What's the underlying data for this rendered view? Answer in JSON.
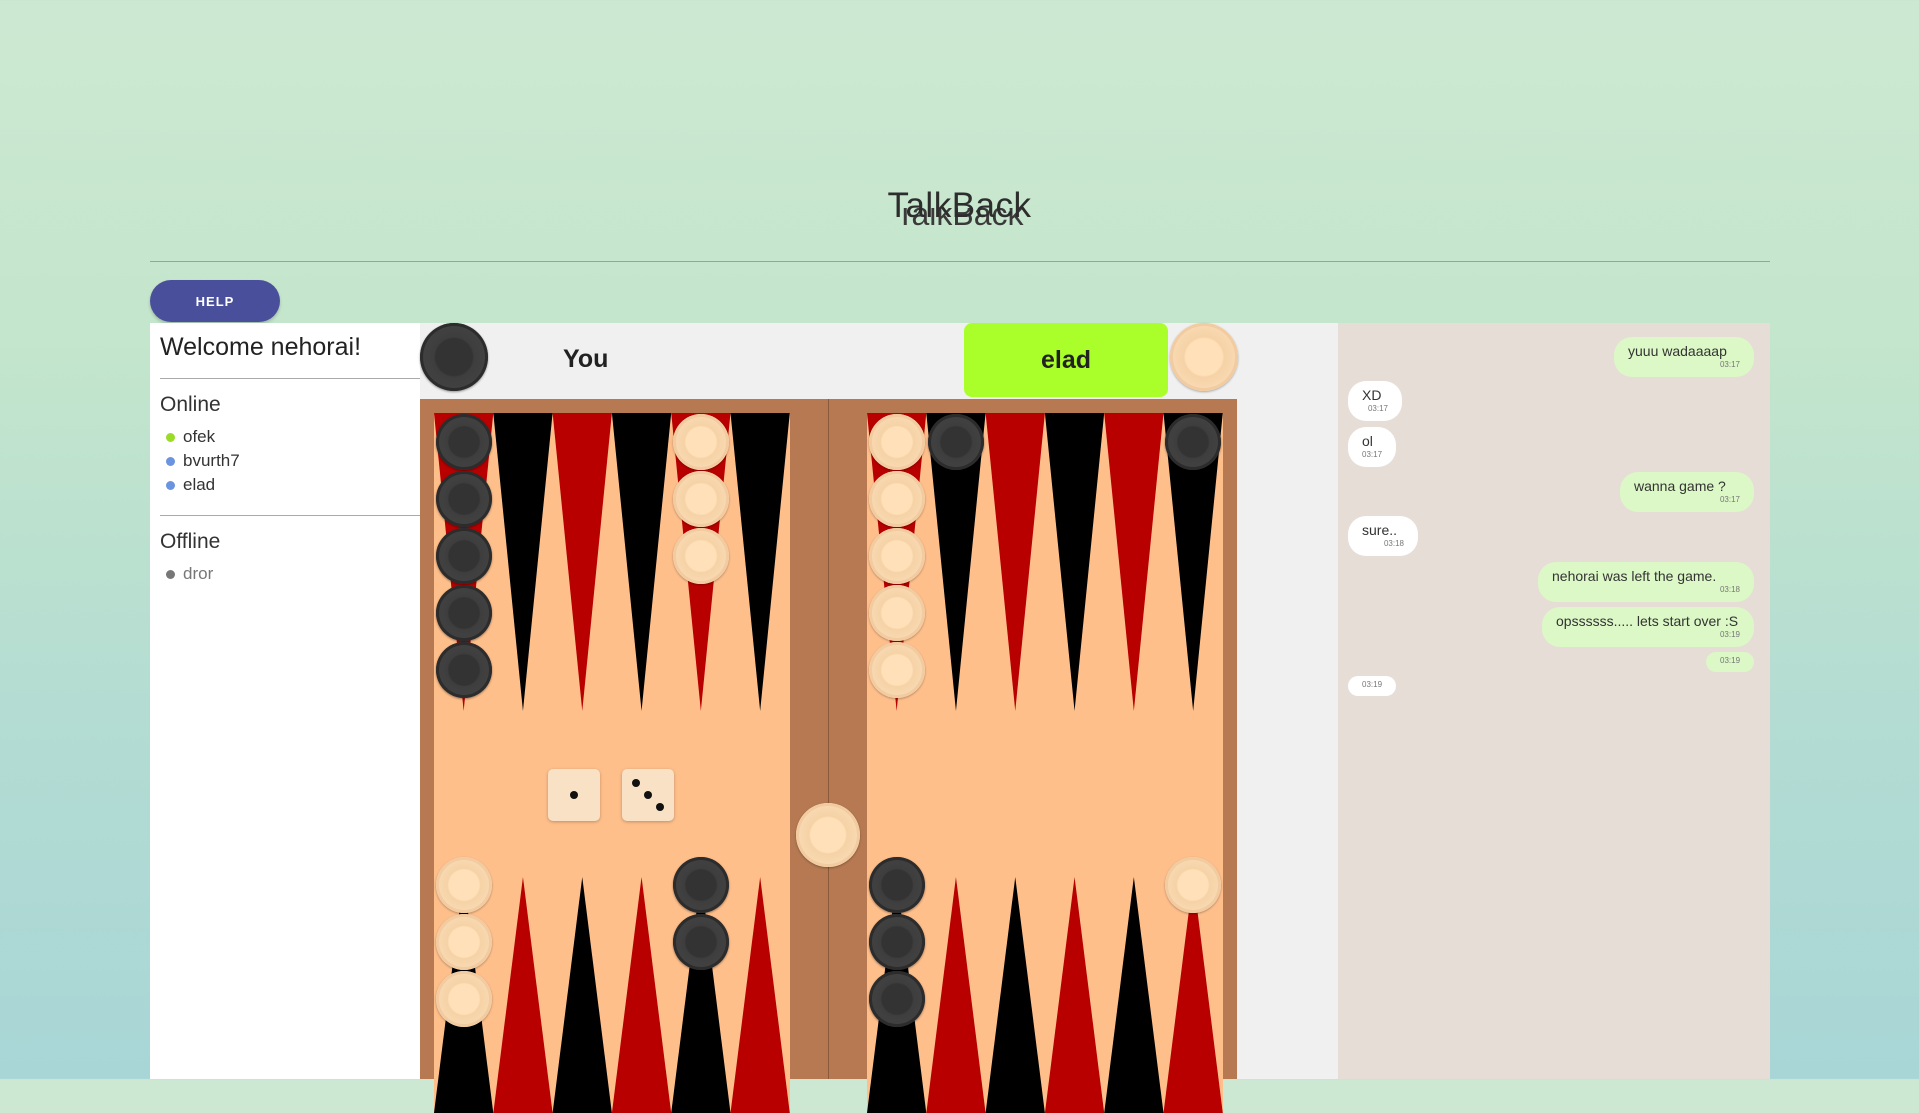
{
  "app": {
    "title": "TalkBack",
    "help_label": "HELP"
  },
  "sidebar": {
    "welcome": "Welcome nehorai!",
    "online_title": "Online",
    "online_users": [
      {
        "name": "ofek",
        "color": "#9bdc28"
      },
      {
        "name": "bvurth7",
        "color": "#6a93e0"
      },
      {
        "name": "elad",
        "color": "#6a93e0"
      }
    ],
    "offline_title": "Offline",
    "offline_users": [
      {
        "name": "dror",
        "color": "#777777"
      }
    ]
  },
  "game": {
    "you_label": "You",
    "opponent_label": "elad",
    "you_color": "#3e3e3e",
    "opponent_color": "#f8d9b0",
    "current_turn": "elad",
    "turn_color": "#aaff2a",
    "dice": [
      1,
      3
    ],
    "colors": {
      "board": "#b67952",
      "field": "#ffbf8b",
      "red_point": "#b80000",
      "black_point": "#000000",
      "dark_checker": "#3e3e3e",
      "light_checker": "#f8d9b0"
    },
    "points_top": [
      {
        "color": "red",
        "checkers": 5,
        "player": "dark"
      },
      {
        "color": "black",
        "checkers": 0
      },
      {
        "color": "red",
        "checkers": 0
      },
      {
        "color": "black",
        "checkers": 0
      },
      {
        "color": "red",
        "checkers": 3,
        "player": "light"
      },
      {
        "color": "black",
        "checkers": 0
      },
      {
        "color": "red",
        "checkers": 5,
        "player": "light"
      },
      {
        "color": "black",
        "checkers": 1,
        "player": "dark"
      },
      {
        "color": "red",
        "checkers": 0
      },
      {
        "color": "black",
        "checkers": 0
      },
      {
        "color": "red",
        "checkers": 0
      },
      {
        "color": "black",
        "checkers": 1,
        "player": "dark"
      }
    ],
    "points_bottom": [
      {
        "color": "black",
        "checkers": 3,
        "player": "light"
      },
      {
        "color": "red",
        "checkers": 0
      },
      {
        "color": "black",
        "checkers": 0
      },
      {
        "color": "red",
        "checkers": 0
      },
      {
        "color": "black",
        "checkers": 2,
        "player": "dark"
      },
      {
        "color": "red",
        "checkers": 0
      },
      {
        "color": "black",
        "checkers": 3,
        "player": "dark"
      },
      {
        "color": "red",
        "checkers": 0
      },
      {
        "color": "black",
        "checkers": 0
      },
      {
        "color": "red",
        "checkers": 0
      },
      {
        "color": "black",
        "checkers": 0
      },
      {
        "color": "red",
        "checkers": 1,
        "player": "light"
      }
    ],
    "bar_checkers": [
      {
        "player": "light"
      }
    ]
  },
  "chat": {
    "messages": [
      {
        "text": "yuuu wadaaaap",
        "time": "03:17",
        "dir": "out"
      },
      {
        "text": "XD",
        "time": "03:17",
        "dir": "in"
      },
      {
        "text": "ol",
        "time": "03:17",
        "dir": "in"
      },
      {
        "text": "wanna game ?",
        "time": "03:17",
        "dir": "out"
      },
      {
        "text": "sure..",
        "time": "03:18",
        "dir": "in"
      },
      {
        "text": "nehorai was left the game.",
        "time": "03:18",
        "dir": "out"
      },
      {
        "text": "opssssss..... lets start over :S",
        "time": "03:19",
        "dir": "out"
      },
      {
        "text": "",
        "time": "03:19",
        "dir": "out"
      },
      {
        "text": "",
        "time": "03:19",
        "dir": "in"
      }
    ]
  }
}
